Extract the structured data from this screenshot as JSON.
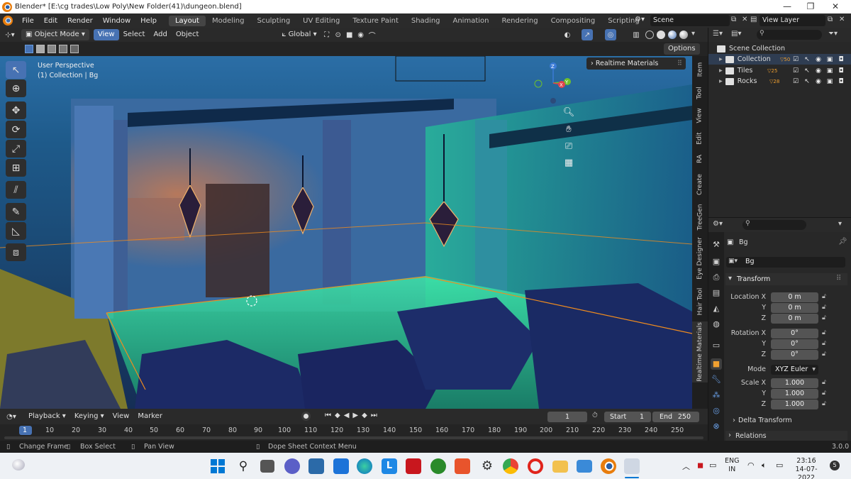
{
  "window": {
    "title": "Blender* [E:\\cg trades\\Low Poly\\New Folder(41)\\dungeon.blend]"
  },
  "menubar": {
    "menus": [
      "File",
      "Edit",
      "Render",
      "Window",
      "Help"
    ],
    "workspaces": [
      "Layout",
      "Modeling",
      "Sculpting",
      "UV Editing",
      "Texture Paint",
      "Shading",
      "Animation",
      "Rendering",
      "Compositing",
      "Scripting"
    ],
    "active_workspace": "Layout",
    "add_tab": "+",
    "scene": "Scene",
    "view_layer": "View Layer"
  },
  "viewport_header": {
    "mode": "Object Mode",
    "menus": [
      "View",
      "Select",
      "Add",
      "Object"
    ],
    "orientation": "Global",
    "options": "Options"
  },
  "viewport": {
    "perspective": "User Perspective",
    "collection_info": "(1) Collection | Bg",
    "realtime_panel": "Realtime Materials",
    "gizmo": {
      "z": "Z",
      "y": "Y",
      "x": "X"
    }
  },
  "side_tabs": [
    "Item",
    "Tool",
    "View",
    "Edit",
    "RA",
    "Create",
    "TreeGen",
    "Eye Designer",
    "Hair Tool",
    "Realtime Materials"
  ],
  "active_side_tab": "Realtime Materials",
  "outliner": {
    "root": "Scene Collection",
    "items": [
      {
        "name": "Collection",
        "badge": "50"
      },
      {
        "name": "Tiles",
        "badge": "25"
      },
      {
        "name": "Rocks",
        "badge": "28"
      }
    ]
  },
  "properties": {
    "object_name": "Bg",
    "object_field": "Bg",
    "transform_header": "Transform",
    "location_label": "Location X",
    "rotation_label": "Rotation X",
    "scale_label": "Scale X",
    "axis_y": "Y",
    "axis_z": "Z",
    "location": [
      "0 m",
      "0 m",
      "0 m"
    ],
    "rotation": [
      "0°",
      "0°",
      "0°"
    ],
    "mode_label": "Mode",
    "mode_value": "XYZ Euler",
    "scale": [
      "1.000",
      "1.000",
      "1.000"
    ],
    "delta_transform": "Delta Transform",
    "relations": "Relations"
  },
  "timeline": {
    "menus": [
      "Playback",
      "Keying",
      "View",
      "Marker"
    ],
    "current_frame": "1",
    "start_label": "Start",
    "start": "1",
    "end_label": "End",
    "end": "250",
    "ruler": [
      "1",
      "10",
      "20",
      "30",
      "40",
      "50",
      "60",
      "70",
      "80",
      "90",
      "100",
      "110",
      "120",
      "130",
      "140",
      "150",
      "160",
      "170",
      "180",
      "190",
      "200",
      "210",
      "220",
      "230",
      "240",
      "250"
    ]
  },
  "statusbar": {
    "items": [
      "Change Frame",
      "Box Select",
      "Pan View",
      "Dope Sheet Context Menu"
    ],
    "version": "3.0.0"
  },
  "taskbar": {
    "language": "ENG",
    "region": "IN",
    "time": "23:16",
    "date": "14-07-2022",
    "notifications": "5"
  },
  "colors": {
    "accent": "#4772b3",
    "selection": "#f08c1e",
    "viewport_top": "#2b6ea6",
    "floor_glow": "#3ee6a8"
  }
}
